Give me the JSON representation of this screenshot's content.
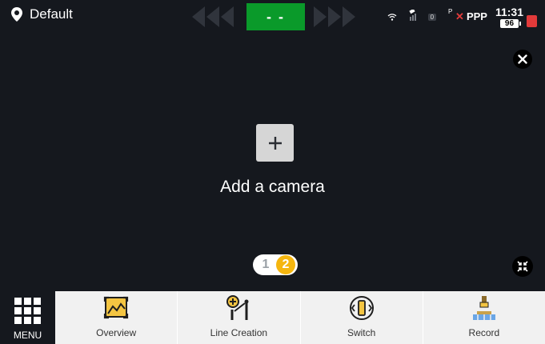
{
  "statusbar": {
    "location": "Default",
    "signal_label": "- -",
    "satellite_count": "0",
    "ppp_sup": "P",
    "ppp_label": "PPP",
    "clock": "11:31",
    "battery": "96"
  },
  "main": {
    "add_camera_label": "Add a camera",
    "pager": {
      "page_one": "1",
      "page_two": "2",
      "current_page": 2
    }
  },
  "bottombar": {
    "menu_label": "MENU",
    "tabs": [
      {
        "label": "Overview",
        "icon": "overview-icon"
      },
      {
        "label": "Line Creation",
        "icon": "line-creation-icon"
      },
      {
        "label": "Switch",
        "icon": "switch-icon"
      },
      {
        "label": "Record",
        "icon": "record-icon"
      }
    ]
  },
  "colors": {
    "background": "#15181e",
    "signal_green": "#0a9a2a",
    "accent_yellow": "#f5b60f",
    "alert_red": "#e23a3a",
    "tab_background": "#f1f1f1"
  }
}
